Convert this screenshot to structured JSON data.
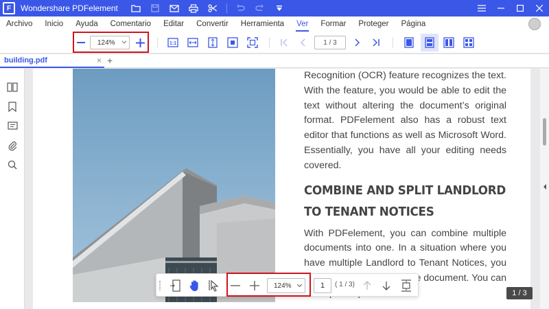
{
  "app": {
    "title": "Wondershare PDFelement",
    "logo_letter": "F"
  },
  "menu": {
    "items": [
      {
        "label": "Archivo",
        "active": false
      },
      {
        "label": "Inicio",
        "active": false
      },
      {
        "label": "Ayuda",
        "active": false
      },
      {
        "label": "Comentario",
        "active": false
      },
      {
        "label": "Editar",
        "active": false
      },
      {
        "label": "Convertir",
        "active": false
      },
      {
        "label": "Herramienta",
        "active": false
      },
      {
        "label": "Ver",
        "active": true
      },
      {
        "label": "Formar",
        "active": false
      },
      {
        "label": "Proteger",
        "active": false
      },
      {
        "label": "Página",
        "active": false
      }
    ]
  },
  "toolbar": {
    "zoom_value": "124%",
    "page_value": "1 / 3"
  },
  "tabs": {
    "doc_name": "building.pdf",
    "close": "×",
    "new_tab": "+"
  },
  "document": {
    "para1": "Recognition (OCR) feature recognizes the text. With the feature, you would be able to edit the text without altering the document’s original format. PDFelement also has a robust text editor that functions as well as Microsoft Word. Essentially, you have all your editing needs covered.",
    "heading": "COMBINE AND SPLIT LANDLORD TO TENANT NOTICES",
    "para2": "With PDFelement, you can combine multiple documents into one. In a situation where you have multiple Landlord to Tenant Notices, you can combine them into one document. You can also split off parts of a"
  },
  "floatbar": {
    "zoom_value": "124%",
    "page_input": "1",
    "page_count": "( 1 / 3)"
  },
  "page_indicator": "1 / 3",
  "colors": {
    "accent": "#3a57e8",
    "highlight": "#d0131b"
  }
}
